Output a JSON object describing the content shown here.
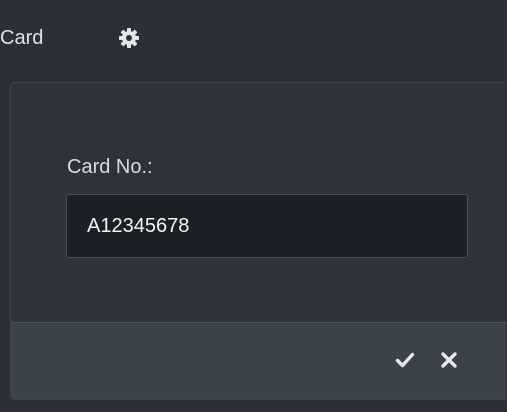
{
  "header": {
    "title": "Card",
    "settings_icon": "gear-icon"
  },
  "form": {
    "card_no_label": "Card No.:",
    "card_no_value": "A12345678"
  },
  "actions": {
    "confirm_icon": "check-icon",
    "cancel_icon": "close-icon"
  },
  "colors": {
    "background": "#2b2f36",
    "panel": "#2e333b",
    "footer": "#3c424a",
    "input_background": "#1c1f25",
    "text": "#dfe3e8"
  }
}
